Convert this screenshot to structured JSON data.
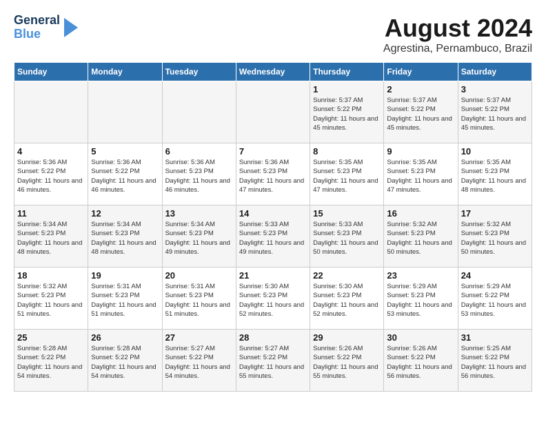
{
  "header": {
    "logo": {
      "line1": "General",
      "line2": "Blue"
    },
    "month_year": "August 2024",
    "location": "Agrestina, Pernambuco, Brazil"
  },
  "days_of_week": [
    "Sunday",
    "Monday",
    "Tuesday",
    "Wednesday",
    "Thursday",
    "Friday",
    "Saturday"
  ],
  "weeks": [
    [
      {
        "day": "",
        "info": ""
      },
      {
        "day": "",
        "info": ""
      },
      {
        "day": "",
        "info": ""
      },
      {
        "day": "",
        "info": ""
      },
      {
        "day": "1",
        "info": "Sunrise: 5:37 AM\nSunset: 5:22 PM\nDaylight: 11 hours and 45 minutes."
      },
      {
        "day": "2",
        "info": "Sunrise: 5:37 AM\nSunset: 5:22 PM\nDaylight: 11 hours and 45 minutes."
      },
      {
        "day": "3",
        "info": "Sunrise: 5:37 AM\nSunset: 5:22 PM\nDaylight: 11 hours and 45 minutes."
      }
    ],
    [
      {
        "day": "4",
        "info": "Sunrise: 5:36 AM\nSunset: 5:22 PM\nDaylight: 11 hours and 46 minutes."
      },
      {
        "day": "5",
        "info": "Sunrise: 5:36 AM\nSunset: 5:22 PM\nDaylight: 11 hours and 46 minutes."
      },
      {
        "day": "6",
        "info": "Sunrise: 5:36 AM\nSunset: 5:23 PM\nDaylight: 11 hours and 46 minutes."
      },
      {
        "day": "7",
        "info": "Sunrise: 5:36 AM\nSunset: 5:23 PM\nDaylight: 11 hours and 47 minutes."
      },
      {
        "day": "8",
        "info": "Sunrise: 5:35 AM\nSunset: 5:23 PM\nDaylight: 11 hours and 47 minutes."
      },
      {
        "day": "9",
        "info": "Sunrise: 5:35 AM\nSunset: 5:23 PM\nDaylight: 11 hours and 47 minutes."
      },
      {
        "day": "10",
        "info": "Sunrise: 5:35 AM\nSunset: 5:23 PM\nDaylight: 11 hours and 48 minutes."
      }
    ],
    [
      {
        "day": "11",
        "info": "Sunrise: 5:34 AM\nSunset: 5:23 PM\nDaylight: 11 hours and 48 minutes."
      },
      {
        "day": "12",
        "info": "Sunrise: 5:34 AM\nSunset: 5:23 PM\nDaylight: 11 hours and 48 minutes."
      },
      {
        "day": "13",
        "info": "Sunrise: 5:34 AM\nSunset: 5:23 PM\nDaylight: 11 hours and 49 minutes."
      },
      {
        "day": "14",
        "info": "Sunrise: 5:33 AM\nSunset: 5:23 PM\nDaylight: 11 hours and 49 minutes."
      },
      {
        "day": "15",
        "info": "Sunrise: 5:33 AM\nSunset: 5:23 PM\nDaylight: 11 hours and 50 minutes."
      },
      {
        "day": "16",
        "info": "Sunrise: 5:32 AM\nSunset: 5:23 PM\nDaylight: 11 hours and 50 minutes."
      },
      {
        "day": "17",
        "info": "Sunrise: 5:32 AM\nSunset: 5:23 PM\nDaylight: 11 hours and 50 minutes."
      }
    ],
    [
      {
        "day": "18",
        "info": "Sunrise: 5:32 AM\nSunset: 5:23 PM\nDaylight: 11 hours and 51 minutes."
      },
      {
        "day": "19",
        "info": "Sunrise: 5:31 AM\nSunset: 5:23 PM\nDaylight: 11 hours and 51 minutes."
      },
      {
        "day": "20",
        "info": "Sunrise: 5:31 AM\nSunset: 5:23 PM\nDaylight: 11 hours and 51 minutes."
      },
      {
        "day": "21",
        "info": "Sunrise: 5:30 AM\nSunset: 5:23 PM\nDaylight: 11 hours and 52 minutes."
      },
      {
        "day": "22",
        "info": "Sunrise: 5:30 AM\nSunset: 5:23 PM\nDaylight: 11 hours and 52 minutes."
      },
      {
        "day": "23",
        "info": "Sunrise: 5:29 AM\nSunset: 5:23 PM\nDaylight: 11 hours and 53 minutes."
      },
      {
        "day": "24",
        "info": "Sunrise: 5:29 AM\nSunset: 5:22 PM\nDaylight: 11 hours and 53 minutes."
      }
    ],
    [
      {
        "day": "25",
        "info": "Sunrise: 5:28 AM\nSunset: 5:22 PM\nDaylight: 11 hours and 54 minutes."
      },
      {
        "day": "26",
        "info": "Sunrise: 5:28 AM\nSunset: 5:22 PM\nDaylight: 11 hours and 54 minutes."
      },
      {
        "day": "27",
        "info": "Sunrise: 5:27 AM\nSunset: 5:22 PM\nDaylight: 11 hours and 54 minutes."
      },
      {
        "day": "28",
        "info": "Sunrise: 5:27 AM\nSunset: 5:22 PM\nDaylight: 11 hours and 55 minutes."
      },
      {
        "day": "29",
        "info": "Sunrise: 5:26 AM\nSunset: 5:22 PM\nDaylight: 11 hours and 55 minutes."
      },
      {
        "day": "30",
        "info": "Sunrise: 5:26 AM\nSunset: 5:22 PM\nDaylight: 11 hours and 56 minutes."
      },
      {
        "day": "31",
        "info": "Sunrise: 5:25 AM\nSunset: 5:22 PM\nDaylight: 11 hours and 56 minutes."
      }
    ]
  ]
}
